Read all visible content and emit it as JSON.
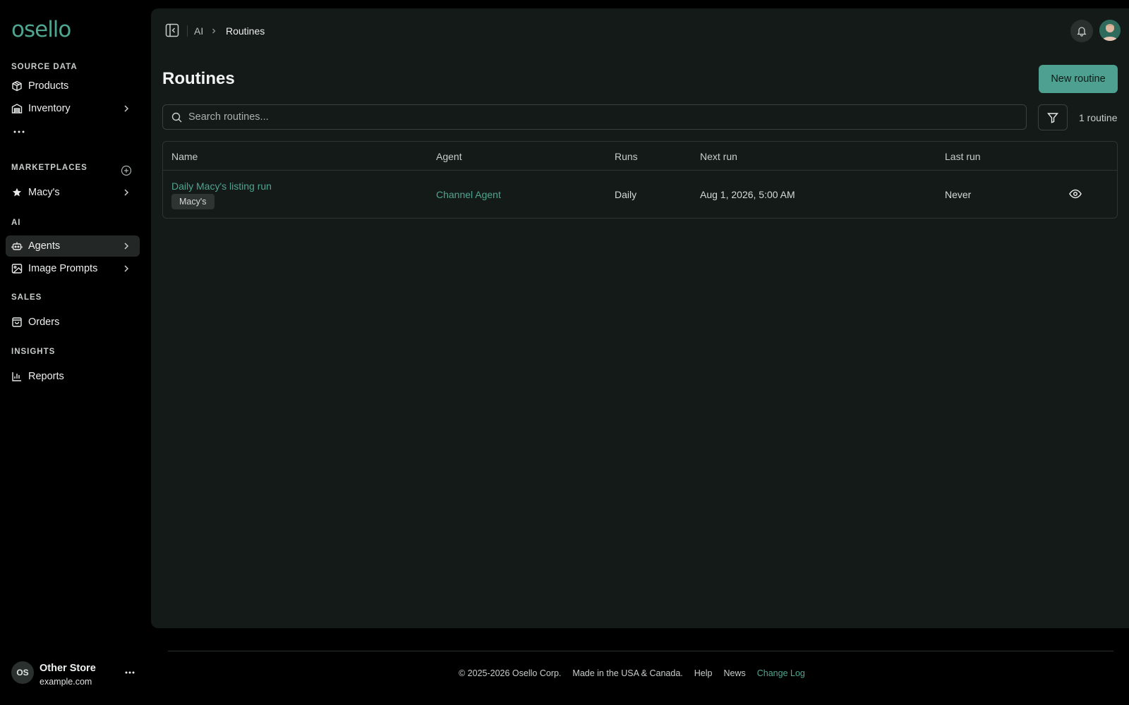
{
  "brand": {
    "logo_text": "osello"
  },
  "sidebar": {
    "sections": {
      "source_data": "SOURCE DATA",
      "marketplaces": "MARKETPLACES",
      "ai": "AI",
      "sales": "SALES",
      "insights": "INSIGHTS"
    },
    "items": {
      "products": "Products",
      "inventory": "Inventory",
      "macys": "Macy's",
      "agents": "Agents",
      "image_prompts": "Image Prompts",
      "orders": "Orders",
      "reports": "Reports"
    },
    "active_item": "Agents",
    "user": {
      "initials": "OS",
      "name": "Other Store",
      "domain": "example.com"
    }
  },
  "breadcrumb": {
    "parent": "AI",
    "current": "Routines"
  },
  "page": {
    "title": "Routines",
    "new_button": "New routine",
    "search_placeholder": "Search routines...",
    "count_label": "1 routine"
  },
  "table": {
    "headers": {
      "name": "Name",
      "agent": "Agent",
      "runs": "Runs",
      "next_run": "Next run",
      "last_run": "Last run"
    },
    "rows": [
      {
        "name": "Daily Macy's listing run",
        "tag": "Macy's",
        "agent": "Channel Agent",
        "runs": "Daily",
        "next_run": "Aug 1, 2026, 5:00 AM",
        "last_run": "Never"
      }
    ]
  },
  "footer": {
    "copyright": "© 2025-2026 Osello Corp.",
    "made_in": "Made in the USA & Canada.",
    "help": "Help",
    "news": "News",
    "changelog": "Change Log"
  },
  "colors": {
    "accent": "#4fa58f",
    "button": "#4ea091",
    "panel": "#131a18",
    "background": "#000000"
  }
}
